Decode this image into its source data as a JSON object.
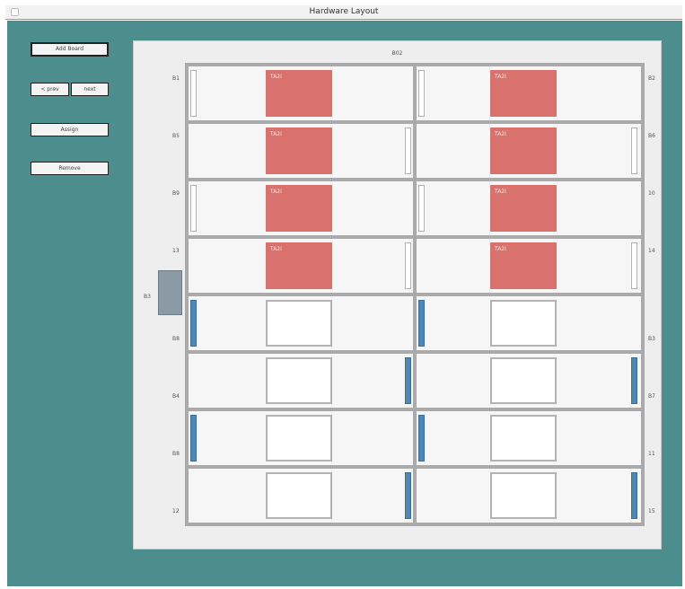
{
  "window": {
    "title": "Hardware Layout"
  },
  "toolbar": {
    "buttons": [
      {
        "name": "add-board-button",
        "label": "Add Board"
      },
      {
        "name": "left-small-button",
        "label": "< prev"
      },
      {
        "name": "right-small-button",
        "label": "next"
      },
      {
        "name": "assign-button",
        "label": "Assign"
      },
      {
        "name": "remove-button",
        "label": "Remove"
      }
    ]
  },
  "board": {
    "label": "B02"
  },
  "side_block_label": "B3",
  "rows": [
    {
      "left_label": "B1",
      "right_label": "B2",
      "left_chip": "TA2I",
      "right_chip": "TA2I",
      "left_state": "occupied",
      "right_state": "occupied"
    },
    {
      "left_label": "B5",
      "right_label": "B6",
      "left_chip": "TA2I",
      "right_chip": "TA2I",
      "left_state": "occupied",
      "right_state": "occupied"
    },
    {
      "left_label": "B9",
      "right_label": "10",
      "left_chip": "TA2I",
      "right_chip": "TA2I",
      "left_state": "occupied",
      "right_state": "occupied"
    },
    {
      "left_label": "13",
      "right_label": "14",
      "left_chip": "TA2I",
      "right_chip": "TA2I",
      "left_state": "occupied",
      "right_state": "occupied"
    },
    {
      "left_label": "B8",
      "right_label": "B3",
      "left_chip": "",
      "right_chip": "",
      "left_state": "empty",
      "right_state": "empty"
    },
    {
      "left_label": "B4",
      "right_label": "B7",
      "left_chip": "",
      "right_chip": "",
      "left_state": "empty",
      "right_state": "empty"
    },
    {
      "left_label": "B8",
      "right_label": "11",
      "left_chip": "",
      "right_chip": "",
      "left_state": "empty",
      "right_state": "empty"
    },
    {
      "left_label": "12",
      "right_label": "15",
      "left_chip": "",
      "right_chip": "",
      "left_state": "empty",
      "right_state": "empty"
    }
  ],
  "colors": {
    "background": "#4b8e8d",
    "occupied_chip": "#d9716d",
    "active_indicator": "#4d87b4"
  }
}
